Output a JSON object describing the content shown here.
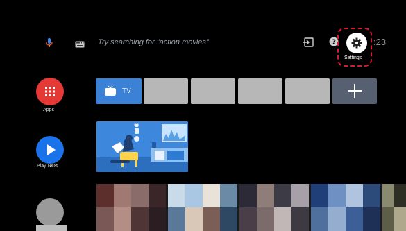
{
  "search": {
    "hint": "Try searching for \"action movies\"",
    "voice_icon": "mic-icon",
    "keyboard_icon": "keyboard-icon"
  },
  "top_right": {
    "input_icon": "input-icon",
    "help_icon": "help-icon",
    "settings_icon": "gear-icon",
    "settings_label": "Settings",
    "clock_visible": ":23",
    "highlight_color": "#d8192e"
  },
  "sidebar": {
    "items": [
      {
        "label": "Apps",
        "icon": "apps-grid-icon",
        "color": "#e53935"
      },
      {
        "label": "Play Next",
        "icon": "play-icon",
        "color": "#1a73e8"
      },
      {
        "label": "",
        "icon": "profile-icon",
        "color": "#9a9a9a"
      }
    ]
  },
  "app_row": {
    "tv_label": "TV",
    "tv_color": "#3b82d6",
    "placeholder_color": "#b7b7b7",
    "add_icon": "plus-icon",
    "add_color": "#566070"
  }
}
